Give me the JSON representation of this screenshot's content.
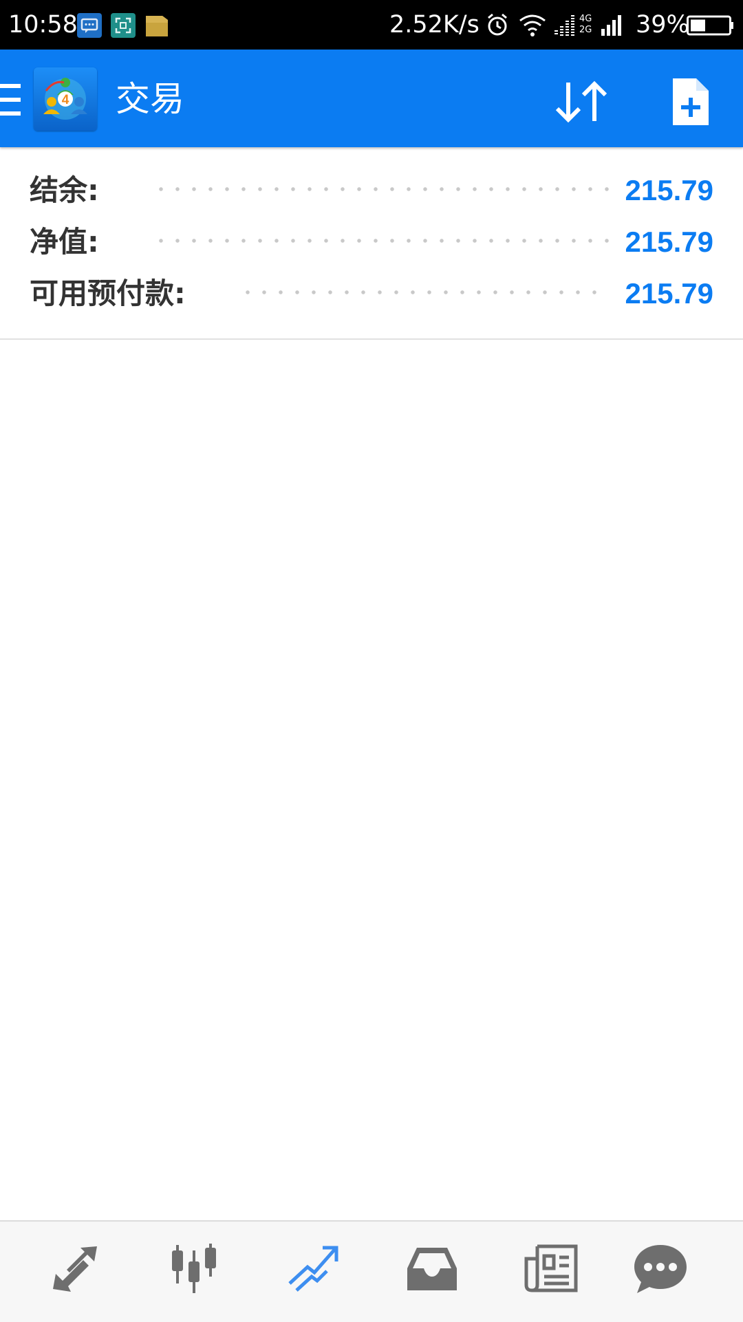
{
  "status_bar": {
    "time": "10:58",
    "network_speed": "2.52K/s",
    "network_type_top": "4G",
    "network_type_bottom": "2G",
    "battery_percent": "39%",
    "battery_level": 0.39,
    "notification_icons": [
      "message-icon",
      "screen-capture-icon",
      "folder-icon"
    ]
  },
  "app_bar": {
    "title": "交易",
    "logo_badge": "4",
    "accent_color": "#0b7cf2"
  },
  "account_summary": [
    {
      "label": "结余:",
      "value": "215.79"
    },
    {
      "label": "净值:",
      "value": "215.79"
    },
    {
      "label": "可用预付款:",
      "value": "215.79"
    }
  ],
  "bottom_nav": {
    "items": [
      {
        "icon": "quotes-arrows-icon",
        "active": false
      },
      {
        "icon": "candlestick-chart-icon",
        "active": false
      },
      {
        "icon": "trade-icon",
        "active": true
      },
      {
        "icon": "history-inbox-icon",
        "active": false
      },
      {
        "icon": "news-icon",
        "active": false
      },
      {
        "icon": "chat-icon",
        "active": false
      }
    ],
    "active_color": "#3d8ef0",
    "inactive_color": "#6e6e6e"
  }
}
